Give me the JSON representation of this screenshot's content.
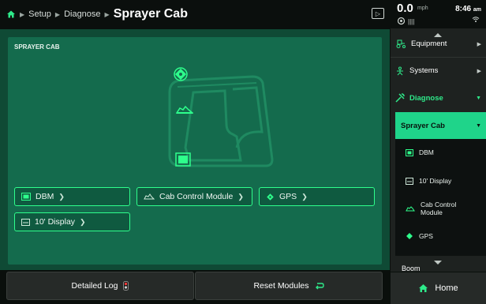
{
  "breadcrumb": {
    "items": [
      "Setup",
      "Diagnose"
    ],
    "current": "Sprayer Cab"
  },
  "status": {
    "speed": "0.0",
    "speed_unit": "mph",
    "signal": "||||",
    "time": "8:46",
    "time_suffix": "am"
  },
  "card": {
    "title": "SPRAYER CAB"
  },
  "modules": [
    {
      "label": "DBM",
      "icon": "dbm-icon"
    },
    {
      "label": "Cab Control Module",
      "icon": "cab-control-icon"
    },
    {
      "label": "GPS",
      "icon": "gps-icon"
    },
    {
      "label": "10' Display",
      "icon": "display-icon"
    }
  ],
  "bottom": {
    "detailed_log": "Detailed Log",
    "reset_modules": "Reset Modules"
  },
  "nav": {
    "equipment": "Equipment",
    "systems": "Systems",
    "diagnose": "Diagnose",
    "sprayer_cab": "Sprayer Cab",
    "sub_items": [
      "DBM",
      "10' Display",
      "Cab Control Module",
      "GPS"
    ],
    "boom": "Boom",
    "home": "Home"
  },
  "colors": {
    "accent": "#2eff8c",
    "panel": "#146b4d",
    "nav_active": "#1fd48a"
  }
}
